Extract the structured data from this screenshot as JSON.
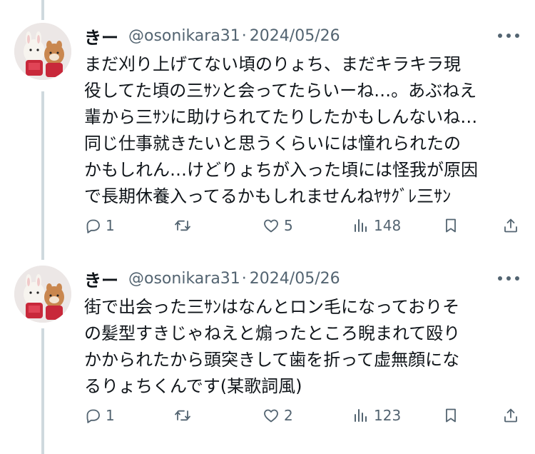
{
  "tweets": [
    {
      "author_name": "きー",
      "handle": "@osonikara31",
      "separator": "·",
      "date": "2024/05/26",
      "lines": [
        "まだ刈り上げてない頃のりょち、まだキラキラ現",
        "役してた頃の三ｻﾝと会ってたらいーね…。あぶねえ",
        "輩から三ｻﾝに助けられてたりしたかもしんないね…",
        "同じ仕事就きたいと思うくらいには憧れられたの",
        "かもしれん…けどりょちが入った頃には怪我が原因",
        "で長期休養入ってるかもしれませんねﾔｻｸﾞﾚ三ｻﾝ"
      ],
      "replies": "1",
      "retweets": "",
      "likes": "5",
      "views": "148",
      "icons": {
        "reply": "reply-icon",
        "retweet": "retweet-icon",
        "like": "heart-icon",
        "views": "views-icon",
        "bookmark": "bookmark-icon",
        "share": "share-icon"
      }
    },
    {
      "author_name": "きー",
      "handle": "@osonikara31",
      "separator": "·",
      "date": "2024/05/26",
      "lines": [
        "街で出会った三ｻﾝはなんとロン毛になっておりそ",
        "の髪型すきじゃねえと煽ったところ睨まれて殴り",
        "かかられたから頭突きして歯を折って虚無顔にな",
        "るりょちくんです(某歌詞風)"
      ],
      "replies": "1",
      "retweets": "",
      "likes": "2",
      "views": "123",
      "icons": {
        "reply": "reply-icon",
        "retweet": "retweet-icon",
        "like": "heart-icon",
        "views": "views-icon",
        "bookmark": "bookmark-icon",
        "share": "share-icon"
      }
    }
  ],
  "colors": {
    "text": "#0f1419",
    "secondary": "#536471",
    "thread_line": "#cfd9de",
    "background": "#ffffff"
  }
}
